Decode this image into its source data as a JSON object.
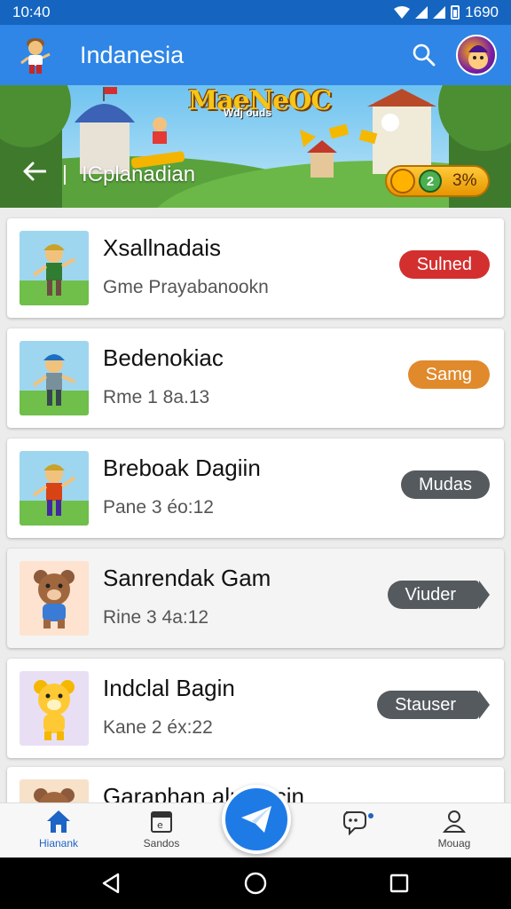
{
  "status_bar": {
    "time": "10:40",
    "battery": "1690"
  },
  "app_bar": {
    "title": "Indanesia",
    "logo_icon": "character-logo-icon",
    "search_icon": "search-icon",
    "avatar_icon": "avatar-icon"
  },
  "banner": {
    "logo_text": "MaeNeOC",
    "logo_subtext": "Wdj ouds",
    "back_icon": "back-arrow-icon",
    "title": "ICplanadian",
    "progress_text": "3%",
    "gem_text": "2"
  },
  "games": [
    {
      "title": "Xsallnadais",
      "subtitle": "Gme Prayabanookn",
      "badge": "Sulned",
      "badge_color": "#d32f2f",
      "thumb": "boy-character-thumbnail"
    },
    {
      "title": "Bedenokiac",
      "subtitle": "Rme 1 8a.13",
      "badge": "Samg",
      "badge_color": "#e08a2c",
      "thumb": "boy-character-thumbnail"
    },
    {
      "title": "Breboak Dagiin",
      "subtitle": "Pane 3 éo:12",
      "badge": "Mudas",
      "badge_color": "#555a5f",
      "thumb": "boy-character-thumbnail"
    },
    {
      "title": "Sanrendak Gam",
      "subtitle": "Rine 3 4a:12",
      "badge": "Viuder",
      "badge_color": "#555a5f",
      "thumb": "bear-character-thumbnail"
    },
    {
      "title": "Indclal Bagin",
      "subtitle": "Kane 2 éx:22",
      "badge": "Stauser",
      "badge_color": "#555a5f",
      "thumb": "yellow-bear-thumbnail"
    },
    {
      "title": "Garaphan alu...bcin",
      "subtitle": "",
      "badge": "",
      "badge_color": "#555a5f",
      "thumb": "bear-character-thumbnail"
    }
  ],
  "bottom_nav": {
    "items": [
      {
        "label": "Hianank",
        "icon": "home-icon",
        "active": true
      },
      {
        "label": "Sandos",
        "icon": "calendar-icon",
        "active": false
      },
      {
        "label": "",
        "icon": "chat-bubble-icon",
        "active": false
      },
      {
        "label": "Mouag",
        "icon": "profile-icon",
        "active": false
      }
    ],
    "fab_icon": "send-icon"
  },
  "system_nav": {
    "back_icon": "back-triangle-icon",
    "home_icon": "home-circle-icon",
    "recents_icon": "recents-square-icon"
  }
}
